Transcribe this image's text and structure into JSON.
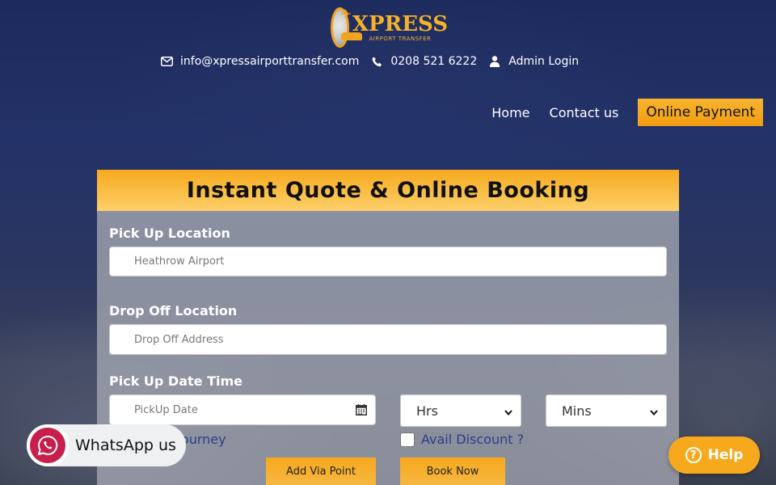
{
  "brand": {
    "logo_name": "XPRESS",
    "logo_sub": "AIRPORT TRANSFER",
    "accent": "#f4b12a"
  },
  "contact": {
    "email": "info@xpressairporttransfer.com",
    "phone": "0208 521 6222",
    "admin": "Admin Login"
  },
  "nav": {
    "home": "Home",
    "contact": "Contact us",
    "payment": "Online Payment"
  },
  "form": {
    "title": "Instant Quote & Online Booking",
    "pickup_label": "Pick Up Location",
    "pickup_value": "Heathrow Airport",
    "dropoff_label": "Drop Off Location",
    "dropoff_placeholder": "Drop Off Address",
    "datetime_label": "Pick Up Date Time",
    "date_placeholder": "PickUp Date",
    "hrs_selected": "Hrs",
    "mins_selected": "Mins",
    "return_label": "Return Journey",
    "discount_label": "Avail Discount ?",
    "via_button": "Add Via Point",
    "book_button": "Book Now"
  },
  "whatsapp": {
    "label": "WhatsApp us"
  },
  "help": {
    "label": "Help",
    "q": "?"
  }
}
